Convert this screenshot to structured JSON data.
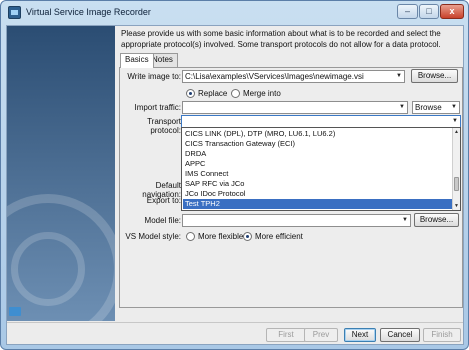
{
  "window": {
    "title": "Virtual Service Image Recorder",
    "controls": {
      "minimize": "–",
      "maximize": "□",
      "close": "x"
    }
  },
  "intro": "Please provide us with some basic information about what is to be recorded and select the appropriate protocol(s) involved.  Some transport protocols do not allow for a data protocol.",
  "tabs": [
    {
      "label": "Basics",
      "active": true
    },
    {
      "label": "Notes",
      "active": false
    }
  ],
  "form": {
    "write_image_label": "Write image to:",
    "write_image_value": "C:\\Lisa\\examples\\VServices\\Images\\newimage.vsi",
    "browse_label": "Browse...",
    "mode_options": [
      {
        "label": "Replace",
        "selected": true
      },
      {
        "label": "Merge into",
        "selected": false
      }
    ],
    "import_traffic_label": "Import traffic:",
    "import_traffic_value": "",
    "import_browse_label": "Browse",
    "transport_label": "Transport protocol:",
    "transport_value": "",
    "default_nav_label": "Default navigation:",
    "export_label": "Export to:",
    "model_file_label": "Model file:",
    "model_file_value": "",
    "model_browse_label": "Browse...",
    "model_style_label": "VS Model style:",
    "model_style_options": [
      {
        "label": "More flexible",
        "selected": false
      },
      {
        "label": "More efficient",
        "selected": true
      }
    ]
  },
  "transport_dropdown": {
    "options": [
      "CICS LINK (DPL), DTP (MRO, LU6.1, LU6.2)",
      "CICS Transaction Gateway (ECI)",
      "DRDA",
      "APPC",
      "IMS Connect",
      "SAP RFC via JCo",
      "JCo IDoc Protocol",
      "Test TPH2"
    ],
    "selected": "Test TPH2",
    "scroll_up": "▲",
    "scroll_down": "▼"
  },
  "footer_buttons": [
    {
      "label": "First",
      "enabled": false
    },
    {
      "label": "Prev",
      "enabled": false
    },
    {
      "label": "Next",
      "enabled": true
    },
    {
      "label": "Cancel",
      "enabled": true
    },
    {
      "label": "Finish",
      "enabled": false
    }
  ],
  "icons": {
    "app": "recorder-app-icon",
    "folder": "folder-icon",
    "arrow": "▼"
  },
  "colors": {
    "selection": "#3a6fc2",
    "side_panel_top": "#2b4d73",
    "side_panel_bottom": "#6d8fb3"
  }
}
